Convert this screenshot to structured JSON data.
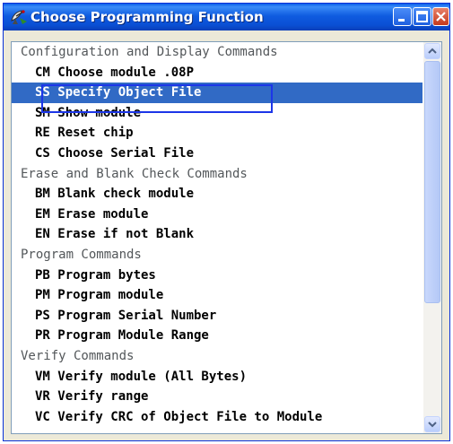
{
  "window": {
    "title": "Choose Programming Function",
    "icon": "satellite-dish-icon"
  },
  "list": {
    "sections": [
      {
        "header": "Configuration and Display Commands",
        "items": [
          {
            "code": "CM",
            "label": "Choose module .08P"
          },
          {
            "code": "SS",
            "label": "Specify Object File",
            "selected": true
          },
          {
            "code": "SM",
            "label": "Show module"
          },
          {
            "code": "RE",
            "label": "Reset chip"
          },
          {
            "code": "CS",
            "label": "Choose Serial File"
          }
        ]
      },
      {
        "header": "Erase and Blank Check Commands",
        "items": [
          {
            "code": "BM",
            "label": "Blank check module"
          },
          {
            "code": "EM",
            "label": "Erase module"
          },
          {
            "code": "EN",
            "label": "Erase if not Blank"
          }
        ]
      },
      {
        "header": "Program Commands",
        "items": [
          {
            "code": "PB",
            "label": "Program bytes"
          },
          {
            "code": "PM",
            "label": "Program module"
          },
          {
            "code": "PS",
            "label": "Program Serial Number"
          },
          {
            "code": "PR",
            "label": "Program Module Range"
          }
        ]
      },
      {
        "header": "Verify Commands",
        "items": [
          {
            "code": "VM",
            "label": "Verify module (All Bytes)"
          },
          {
            "code": "VR",
            "label": "Verify range"
          },
          {
            "code": "VC",
            "label": "Verify CRC of Object File to Module"
          }
        ]
      }
    ]
  },
  "colors": {
    "titlebar": "#0a5ee8",
    "selection": "#316ac5",
    "highlight_box": "#1c36e8",
    "section_header_text": "#53575a"
  }
}
